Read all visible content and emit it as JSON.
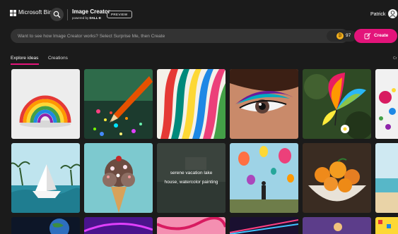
{
  "header": {
    "brand": "Microsoft Bing",
    "product_title": "Image Creator",
    "powered_prefix": "powered by ",
    "powered_model": "DALL·E",
    "preview_badge": "PREVIEW",
    "user_name": "Patrick"
  },
  "search": {
    "placeholder": "Want to see how Image Creator works? Select Surprise Me, then Create",
    "coins": "97",
    "create_label": "Create"
  },
  "tabs": {
    "explore": "Explore ideas",
    "creations": "Creations",
    "cut_off": "Cr"
  },
  "tiles": {
    "hover_caption_line1": "serene vacation lake",
    "hover_caption_line2": "house, watercolor painting"
  },
  "colors": {
    "accent": "#e3147a",
    "background": "#1b1b1b",
    "coin": "#f2b01e"
  }
}
